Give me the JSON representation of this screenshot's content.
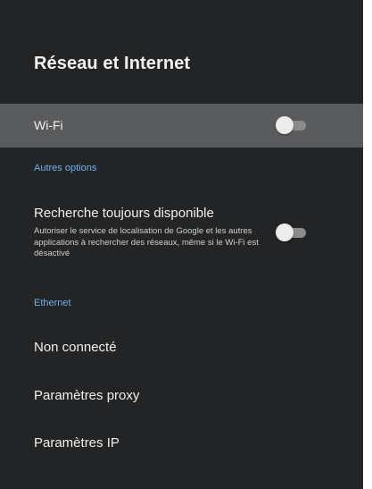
{
  "page": {
    "title": "Réseau et Internet"
  },
  "wifi": {
    "label": "Wi-Fi",
    "enabled": false
  },
  "sections": {
    "autres_options": "Autres options",
    "ethernet": "Ethernet"
  },
  "recherche": {
    "label": "Recherche toujours disponible",
    "description": "Autoriser le service de localisation de Google et les autres applications à rechercher des réseaux, même si le Wi-Fi est désactivé",
    "enabled": false
  },
  "ethernet_items": {
    "status": "Non connecté",
    "proxy": "Paramètres proxy",
    "ip": "Paramètres IP"
  },
  "colors": {
    "background": "#232425",
    "selected_row": "#5a5b5d",
    "section_accent": "#6fb0e8",
    "text": "#f0f0f0"
  }
}
